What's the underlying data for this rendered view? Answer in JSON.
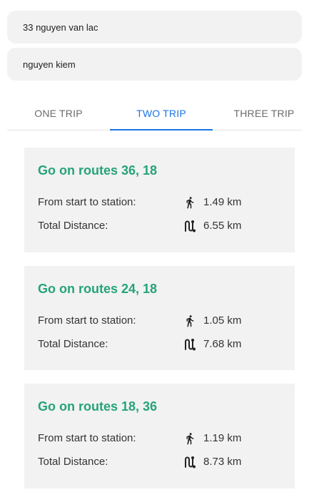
{
  "origin": {
    "value": "33 nguyen van lac"
  },
  "destination": {
    "value": "nguyen kiem"
  },
  "tabs": [
    {
      "label": "ONE TRIP",
      "active": false
    },
    {
      "label": "TWO TRIP",
      "active": true
    },
    {
      "label": "THREE TRIP",
      "active": false
    }
  ],
  "results": [
    {
      "title": "Go on routes 36, 18",
      "walk_label": "From start to station:",
      "walk_value": "1.49 km",
      "total_label": "Total Distance:",
      "total_value": "6.55 km"
    },
    {
      "title": "Go on routes 24, 18",
      "walk_label": "From start to station:",
      "walk_value": "1.05 km",
      "total_label": "Total Distance:",
      "total_value": "7.68 km"
    },
    {
      "title": "Go on routes 18, 36",
      "walk_label": "From start to station:",
      "walk_value": "1.19 km",
      "total_label": "Total Distance:",
      "total_value": "8.73 km"
    }
  ],
  "icons": {
    "walk": "walking-person-icon",
    "route": "route-path-icon"
  },
  "colors": {
    "accent": "#1a73e8",
    "route_title": "#26a37a",
    "field_bg": "#f2f2f2",
    "card_bg": "#f2f2f2"
  }
}
